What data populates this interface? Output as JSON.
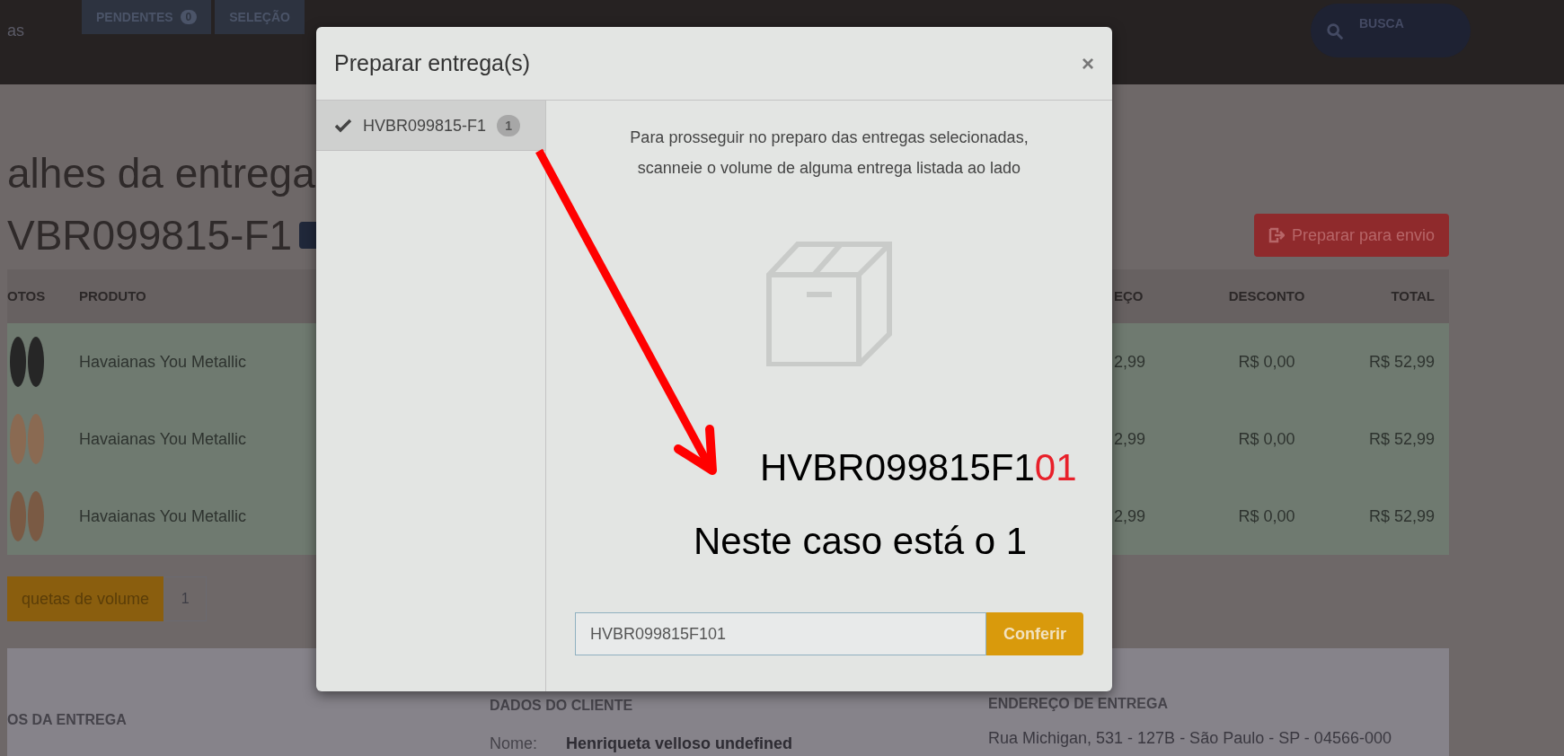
{
  "topbar": {
    "left_text": "as",
    "tabs": [
      {
        "label": "PENDENTES",
        "count": "0"
      },
      {
        "label": "SELEÇÃO"
      }
    ],
    "search": {
      "label": "BUSCA"
    }
  },
  "page": {
    "title": "alhes da entrega",
    "delivery_id": "VBR099815-F1",
    "action_button": "Preparar para envio"
  },
  "table": {
    "columns": [
      "OTOS",
      "PRODUTO",
      "EÇO",
      "DESCONTO",
      "TOTAL"
    ],
    "rows": [
      {
        "product": "Havaianas You Metallic",
        "price": "2,99",
        "discount": "R$ 0,00",
        "total": "R$ 52,99",
        "color": "#262626"
      },
      {
        "product": "Havaianas You Metallic",
        "price": "2,99",
        "discount": "R$ 0,00",
        "total": "R$ 52,99",
        "color": "#8a6a52"
      },
      {
        "product": "Havaianas You Metallic",
        "price": "2,99",
        "discount": "R$ 0,00",
        "total": "R$ 52,99",
        "color": "#7a5a44"
      }
    ]
  },
  "labels_button": {
    "label": "quetas de volume",
    "count": "1"
  },
  "sections": {
    "delivery": {
      "heading": "OS DA ENTREGA"
    },
    "client": {
      "heading": "DADOS DO CLIENTE",
      "name_label": "Nome:",
      "name": "Henriqueta velloso undefined"
    },
    "address": {
      "heading": "ENDEREÇO DE ENTREGA",
      "text": "Rua Michigan, 531 - 127B - São Paulo - SP - 04566-000"
    }
  },
  "modal": {
    "title": "Preparar entrega(s)",
    "close": "×",
    "deliveries": [
      {
        "code": "HVBR099815-F1",
        "count": "1",
        "selected": true
      }
    ],
    "instructions": "Para prosseguir no preparo das entregas selecionadas, scanneie o volume de alguma entrega listada ao lado",
    "input": {
      "value": "HVBR099815F101"
    },
    "button": "Conferir"
  },
  "annotation": {
    "code": "HVBR099815F1",
    "code_highlight": "01",
    "note": "Neste caso está o 1"
  }
}
